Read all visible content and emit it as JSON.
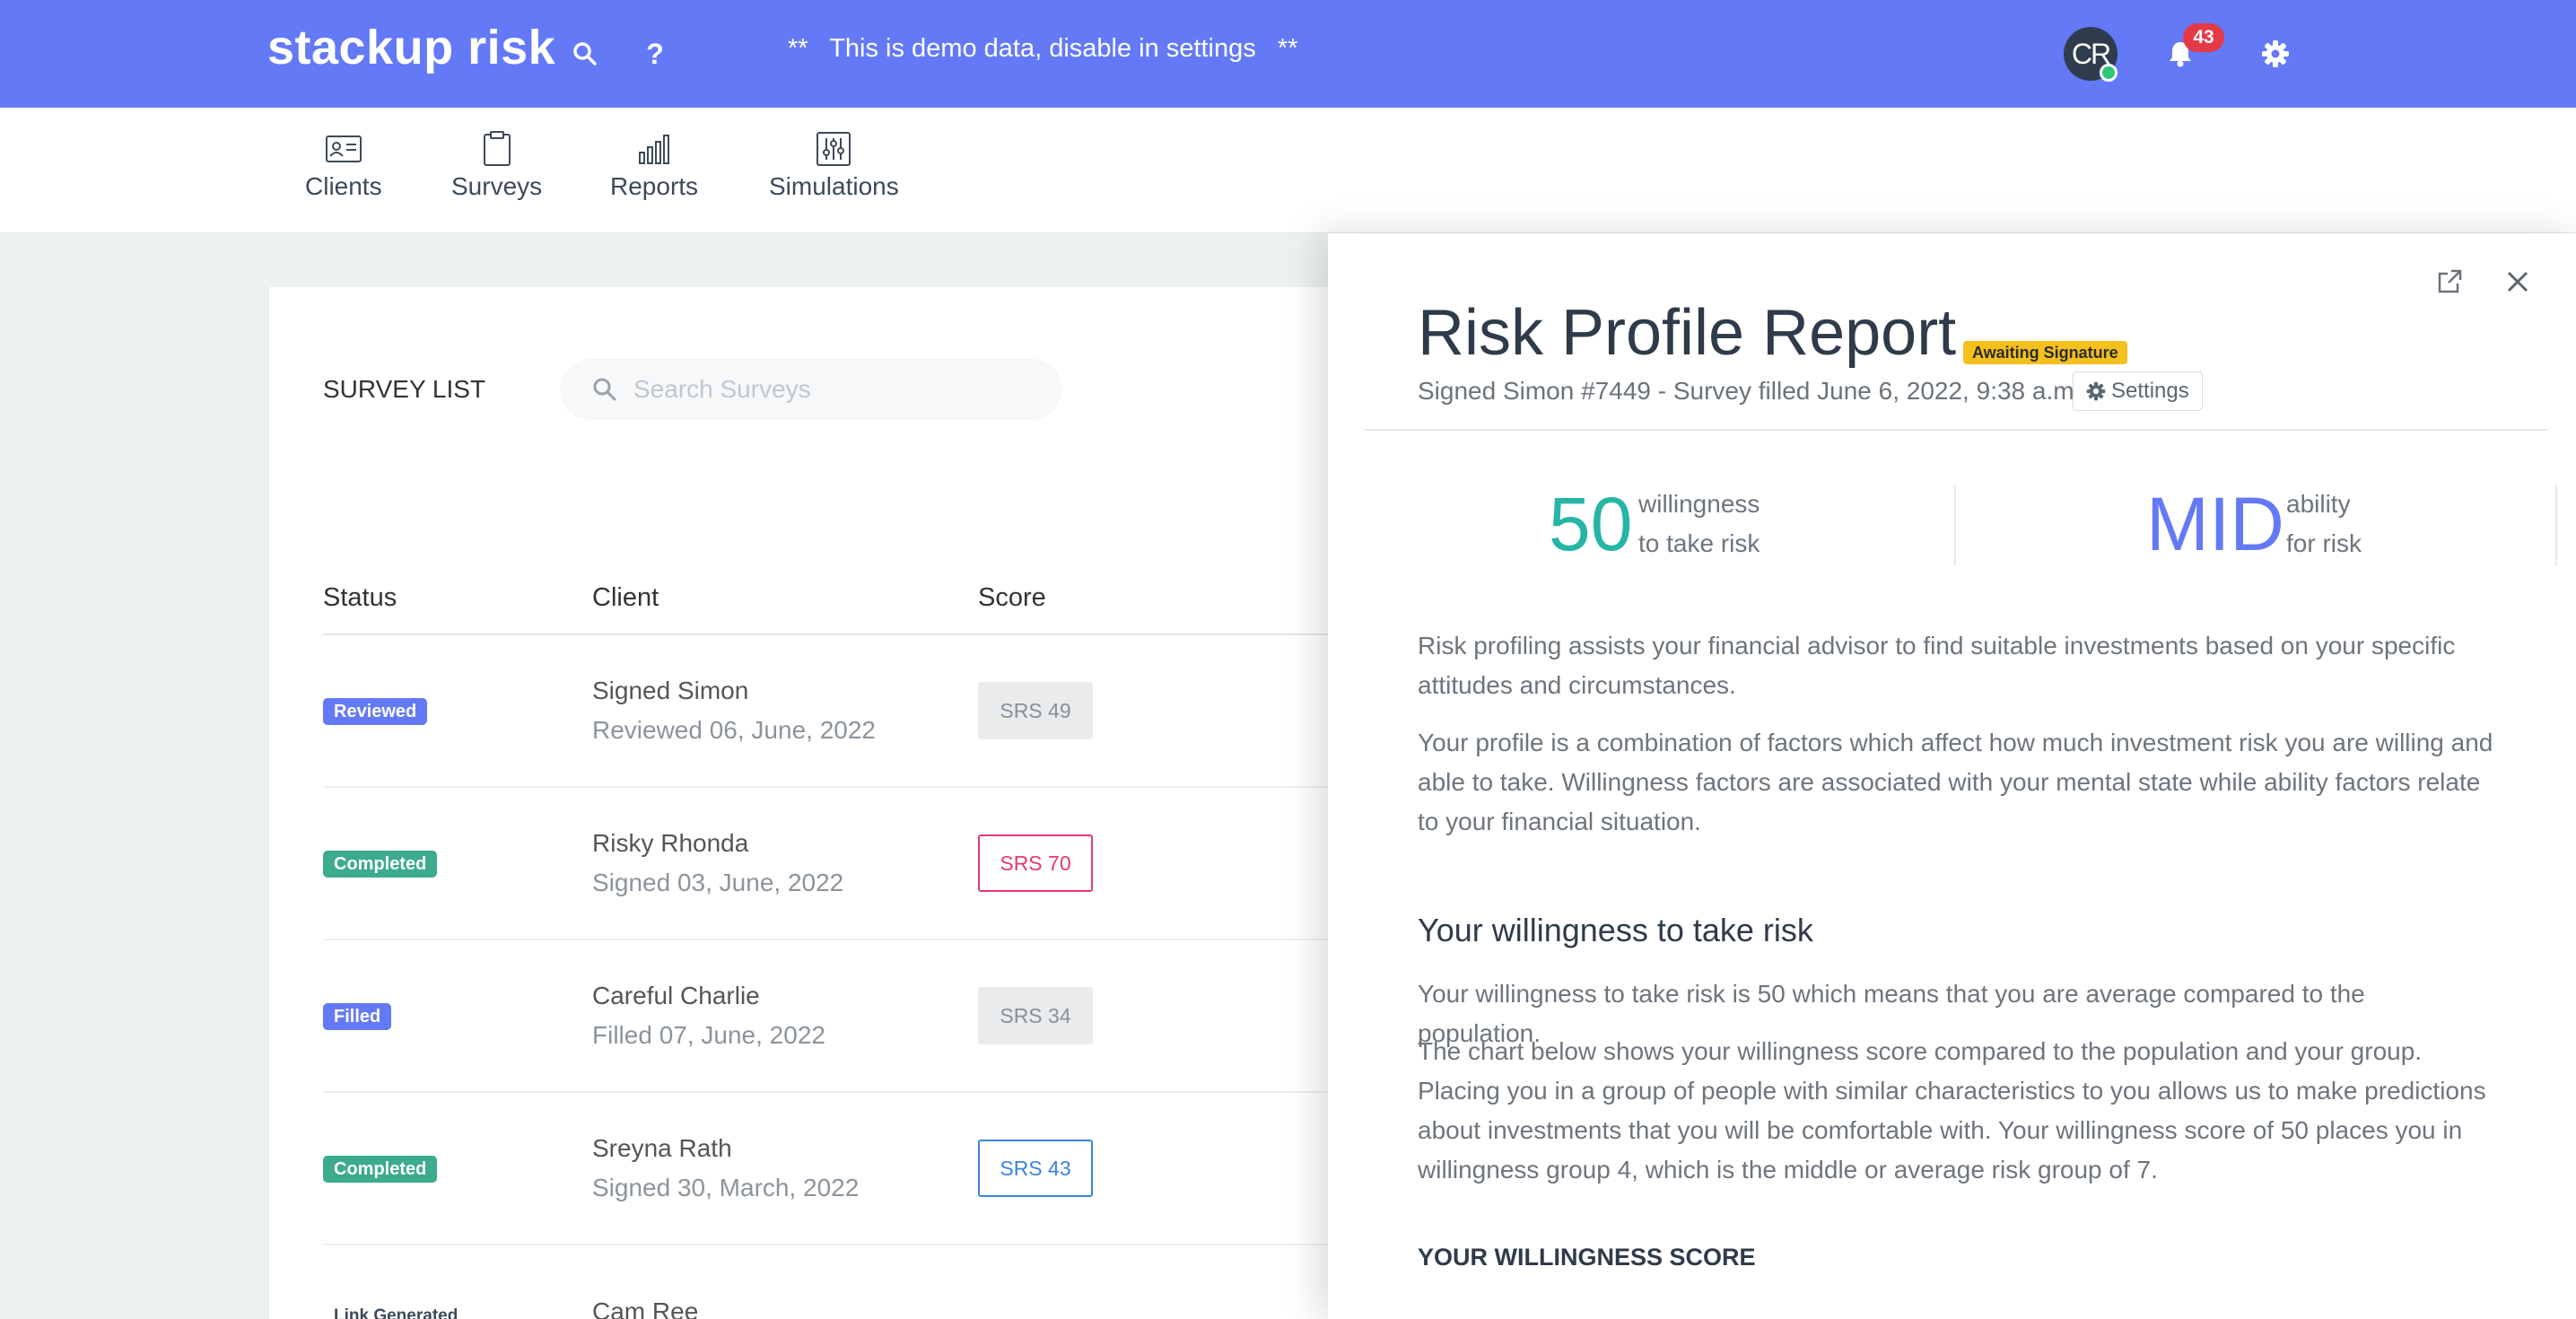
{
  "header": {
    "logo": "stackup risk",
    "demo_notice": "**   This is demo data, disable in settings   **",
    "avatar_initials": "CR",
    "notification_count": "43",
    "icons": [
      "search-icon",
      "help-icon",
      "bell-icon",
      "gear-icon"
    ]
  },
  "nav": {
    "items": [
      {
        "label": "Clients",
        "icon": "id-card-icon"
      },
      {
        "label": "Surveys",
        "icon": "clipboard-icon"
      },
      {
        "label": "Reports",
        "icon": "bar-chart-icon"
      },
      {
        "label": "Simulations",
        "icon": "sliders-icon"
      }
    ]
  },
  "survey_list": {
    "title": "SURVEY LIST",
    "search_placeholder": "Search Surveys",
    "columns": [
      "Status",
      "Client",
      "Score"
    ],
    "rows": [
      {
        "status": "Reviewed",
        "status_color": "#6479f6",
        "client": "Signed Simon",
        "sub": "Reviewed 06, June, 2022",
        "score": "SRS 49",
        "score_style": "grey"
      },
      {
        "status": "Completed",
        "status_color": "#3cab8e",
        "client": "Risky Rhonda",
        "sub": "Signed 03, June, 2022",
        "score": "SRS 70",
        "score_style": "red"
      },
      {
        "status": "Filled",
        "status_color": "#6479f6",
        "client": "Careful Charlie",
        "sub": "Filled 07, June, 2022",
        "score": "SRS 34",
        "score_style": "grey"
      },
      {
        "status": "Completed",
        "status_color": "#3cab8e",
        "client": "Sreyna Rath",
        "sub": "Signed 30, March, 2022",
        "score": "SRS 43",
        "score_style": "blue"
      },
      {
        "status": "Link Generated",
        "status_color": "#ffffff",
        "client": "Cam Ree",
        "sub": "",
        "score": "",
        "score_style": "none"
      }
    ]
  },
  "report": {
    "title": "Risk Profile Report",
    "badge": "Awaiting Signature",
    "subtitle": "Signed Simon #7449 - Survey filled June 6, 2022, 9:38 a.m.",
    "settings_label": "Settings",
    "willingness_value": "50",
    "willingness_label_1": "willingness",
    "willingness_label_2": "to take risk",
    "ability_value": "MID",
    "ability_label_1": "ability",
    "ability_label_2": "for risk",
    "intro_1": "Risk profiling assists your financial advisor to find suitable investments based on your specific attitudes and circumstances.",
    "intro_2": "Your profile is a combination of factors which affect how much investment risk you are willing and able to take. Willingness factors are associated with your mental state while ability factors relate to your financial situation.",
    "section_title": "Your willingness to take risk",
    "section_p1": "Your willingness to take risk is 50 which means that you are average compared to the population.",
    "section_p2": "The chart below shows your willingness score compared to the population and your group. Placing you in a group of people with similar characteristics to you allows us to make predictions about investments that you will be comfortable with. Your willingness score of 50 places you in willingness group 4, which is the middle or average risk group of 7.",
    "score_heading": "YOUR WILLINGNESS SCORE"
  },
  "colors": {
    "brand": "#6479f6",
    "willingness": "#27b5a5",
    "ability": "#6479f6",
    "badge_yellow": "#f4c01e",
    "danger": "#e53946"
  }
}
